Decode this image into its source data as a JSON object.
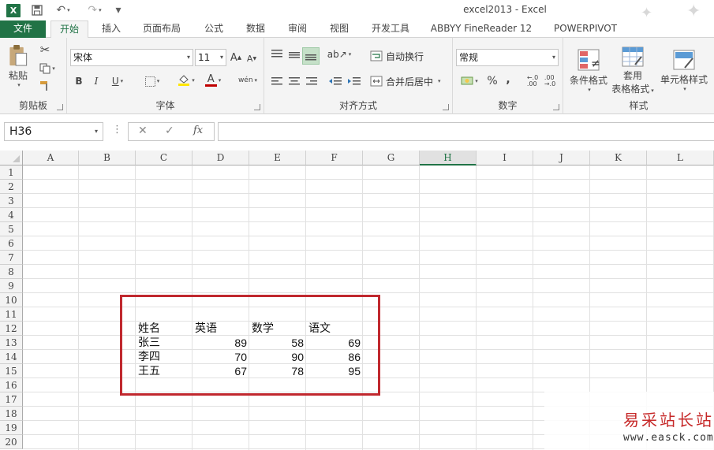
{
  "window": {
    "title": "excel2013 - Excel"
  },
  "quick_access": {
    "app_icon": "X",
    "custom_arrow": "▾"
  },
  "tabs": [
    {
      "label": "文件"
    },
    {
      "label": "开始"
    },
    {
      "label": "插入"
    },
    {
      "label": "页面布局"
    },
    {
      "label": "公式"
    },
    {
      "label": "数据"
    },
    {
      "label": "审阅"
    },
    {
      "label": "视图"
    },
    {
      "label": "开发工具"
    },
    {
      "label": "ABBYY FineReader 12"
    },
    {
      "label": "POWERPIVOT"
    }
  ],
  "ribbon": {
    "clipboard": {
      "label": "剪贴板",
      "paste": "粘贴"
    },
    "font": {
      "label": "字体",
      "font_name": "宋体",
      "font_size": "11",
      "bold": "B",
      "italic": "I",
      "underline": "U",
      "wen": "wén"
    },
    "alignment": {
      "label": "对齐方式",
      "wrap_text": "自动换行",
      "merge_center": "合并后居中"
    },
    "number": {
      "label": "数字",
      "format": "常规",
      "percent": "%",
      "comma": ","
    },
    "styles": {
      "label": "样式",
      "conditional": "条件格式",
      "table_fmt_line1": "套用",
      "table_fmt_line2": "表格格式",
      "cell_styles": "单元格样式"
    }
  },
  "formula_bar": {
    "name_box": "H36",
    "fx": "fx",
    "cancel": "✕",
    "enter": "✓",
    "more": "⋮",
    "value": ""
  },
  "grid": {
    "columns": [
      "A",
      "B",
      "C",
      "D",
      "E",
      "F",
      "G",
      "H",
      "I",
      "J",
      "K",
      "L"
    ],
    "selected_column": "H",
    "rows": [
      "1",
      "2",
      "3",
      "4",
      "5",
      "6",
      "7",
      "8",
      "9",
      "10",
      "11",
      "12",
      "13",
      "14",
      "15",
      "16",
      "17",
      "18",
      "19",
      "20"
    ],
    "table": {
      "header": [
        "姓名",
        "英语",
        "数学",
        "语文"
      ],
      "rows": [
        {
          "name": "张三",
          "english": "89",
          "math": "58",
          "chinese": "69"
        },
        {
          "name": "李四",
          "english": "70",
          "math": "90",
          "chinese": "86"
        },
        {
          "name": "王五",
          "english": "67",
          "math": "78",
          "chinese": "95"
        }
      ]
    }
  },
  "watermark": {
    "text": "易采站长站",
    "url": "www.easck.com"
  },
  "colors": {
    "excel_green": "#217346",
    "highlight_red": "#c0282e"
  }
}
